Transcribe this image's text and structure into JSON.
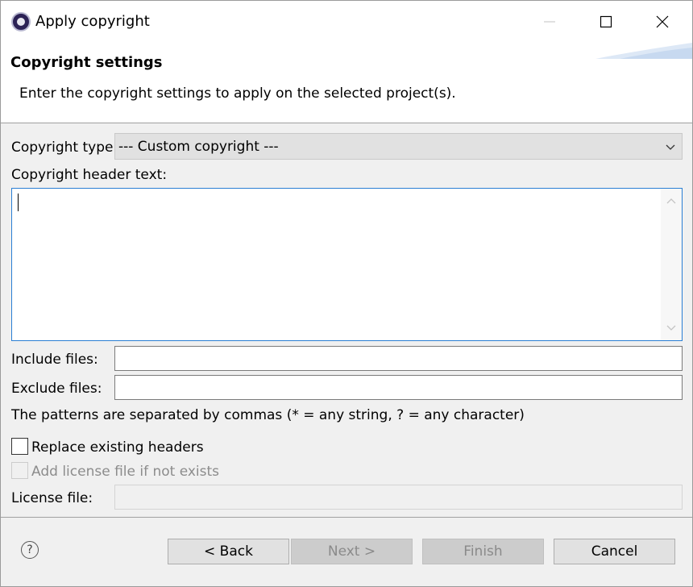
{
  "window": {
    "title": "Apply copyright",
    "app_icon": "eclipse-icon"
  },
  "banner": {
    "title": "Copyright settings",
    "description": "Enter the copyright settings to apply on the selected project(s)."
  },
  "form": {
    "copyright_type_label": "Copyright type:",
    "copyright_type_value": "--- Custom copyright ---",
    "header_text_label": "Copyright header text:",
    "header_text_value": "",
    "include_files_label": "Include files:",
    "include_files_value": "",
    "exclude_files_label": "Exclude files:",
    "exclude_files_value": "",
    "patterns_hint": "The patterns are separated by commas (* = any string, ? = any character)",
    "replace_headers_label": "Replace existing headers",
    "replace_headers_checked": false,
    "add_license_label": "Add license file if not exists",
    "add_license_checked": false,
    "license_file_label": "License file:",
    "license_file_value": ""
  },
  "buttons": {
    "help": "?",
    "back": "< Back",
    "next": "Next >",
    "finish": "Finish",
    "cancel": "Cancel"
  },
  "colors": {
    "focus_border": "#2a7fd4",
    "dialog_background": "#f0f0f0",
    "button_background": "#e1e1e1",
    "disabled_text": "#8c8c8c"
  }
}
